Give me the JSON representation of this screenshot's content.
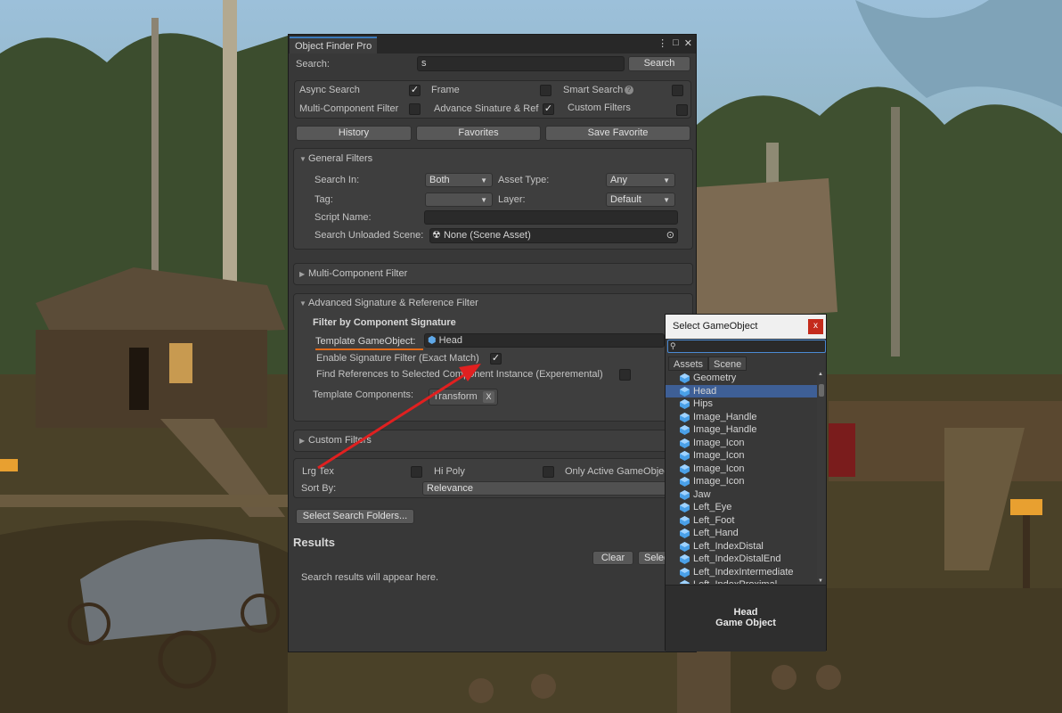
{
  "window": {
    "title": "Object Finder Pro",
    "menu_icon": "⋮",
    "maximize_icon": "□",
    "close_icon": "✕"
  },
  "search": {
    "label": "Search:",
    "value": "s",
    "button": "Search"
  },
  "toggles": {
    "async_search": "Async Search",
    "frame": "Frame",
    "smart_search": "Smart Search",
    "help_icon": "?",
    "multi_component": "Multi-Component Filter",
    "advance_signature": "Advance Sinature & Ref",
    "custom_filters": "Custom Filters"
  },
  "actions": {
    "history": "History",
    "favorites": "Favorites",
    "save_favorite": "Save Favorite"
  },
  "general_filters": {
    "header": "General Filters",
    "search_in_label": "Search In:",
    "search_in_value": "Both",
    "asset_type_label": "Asset Type:",
    "asset_type_value": "Any",
    "tag_label": "Tag:",
    "tag_value": "",
    "layer_label": "Layer:",
    "layer_value": "Default",
    "script_name_label": "Script Name:",
    "script_name_value": "",
    "unloaded_scene_label": "Search Unloaded Scene:",
    "unloaded_scene_value": "None (Scene Asset)"
  },
  "multi_component": {
    "header": "Multi-Component Filter"
  },
  "advanced_signature": {
    "header": "Advanced Signature & Reference Filter",
    "subheader": "Filter by Component Signature",
    "template_label": "Template GameObject:",
    "template_value": "Head",
    "enable_signature": "Enable Signature Filter (Exact Match)",
    "find_references": "Find References to Selected Component Instance (Experemental)",
    "template_components_label": "Template Components:",
    "component_chip": "Transform",
    "chip_remove": "X"
  },
  "custom_filters": {
    "header": "Custom Filters",
    "lrg_tex": "Lrg Tex",
    "hi_poly": "Hi Poly",
    "only_active": "Only Active GameObject",
    "sort_by_label": "Sort By:",
    "sort_by_value": "Relevance"
  },
  "folders_button": "Select Search Folders...",
  "results": {
    "header": "Results",
    "clear": "Clear",
    "select": "Select",
    "placeholder": "Search results will appear here."
  },
  "popup": {
    "title": "Select GameObject",
    "close": "x",
    "search_value": "",
    "tabs": [
      "Assets",
      "Scene"
    ],
    "active_tab": "Scene",
    "items": [
      "Geometry",
      "Head",
      "Hips",
      "Image_Handle",
      "Image_Handle",
      "Image_Icon",
      "Image_Icon",
      "Image_Icon",
      "Image_Icon",
      "Jaw",
      "Left_Eye",
      "Left_Foot",
      "Left_Hand",
      "Left_IndexDistal",
      "Left_IndexDistalEnd",
      "Left_IndexIntermediate",
      "Left_IndexProximal"
    ],
    "selected_item": "Head",
    "preview_name": "Head",
    "preview_type": "Game Object"
  },
  "colors": {
    "accent": "#3a79bb",
    "selection": "#3e5f96",
    "annotation_arrow": "#e02020",
    "annotation_underline": "#e06a1a"
  }
}
